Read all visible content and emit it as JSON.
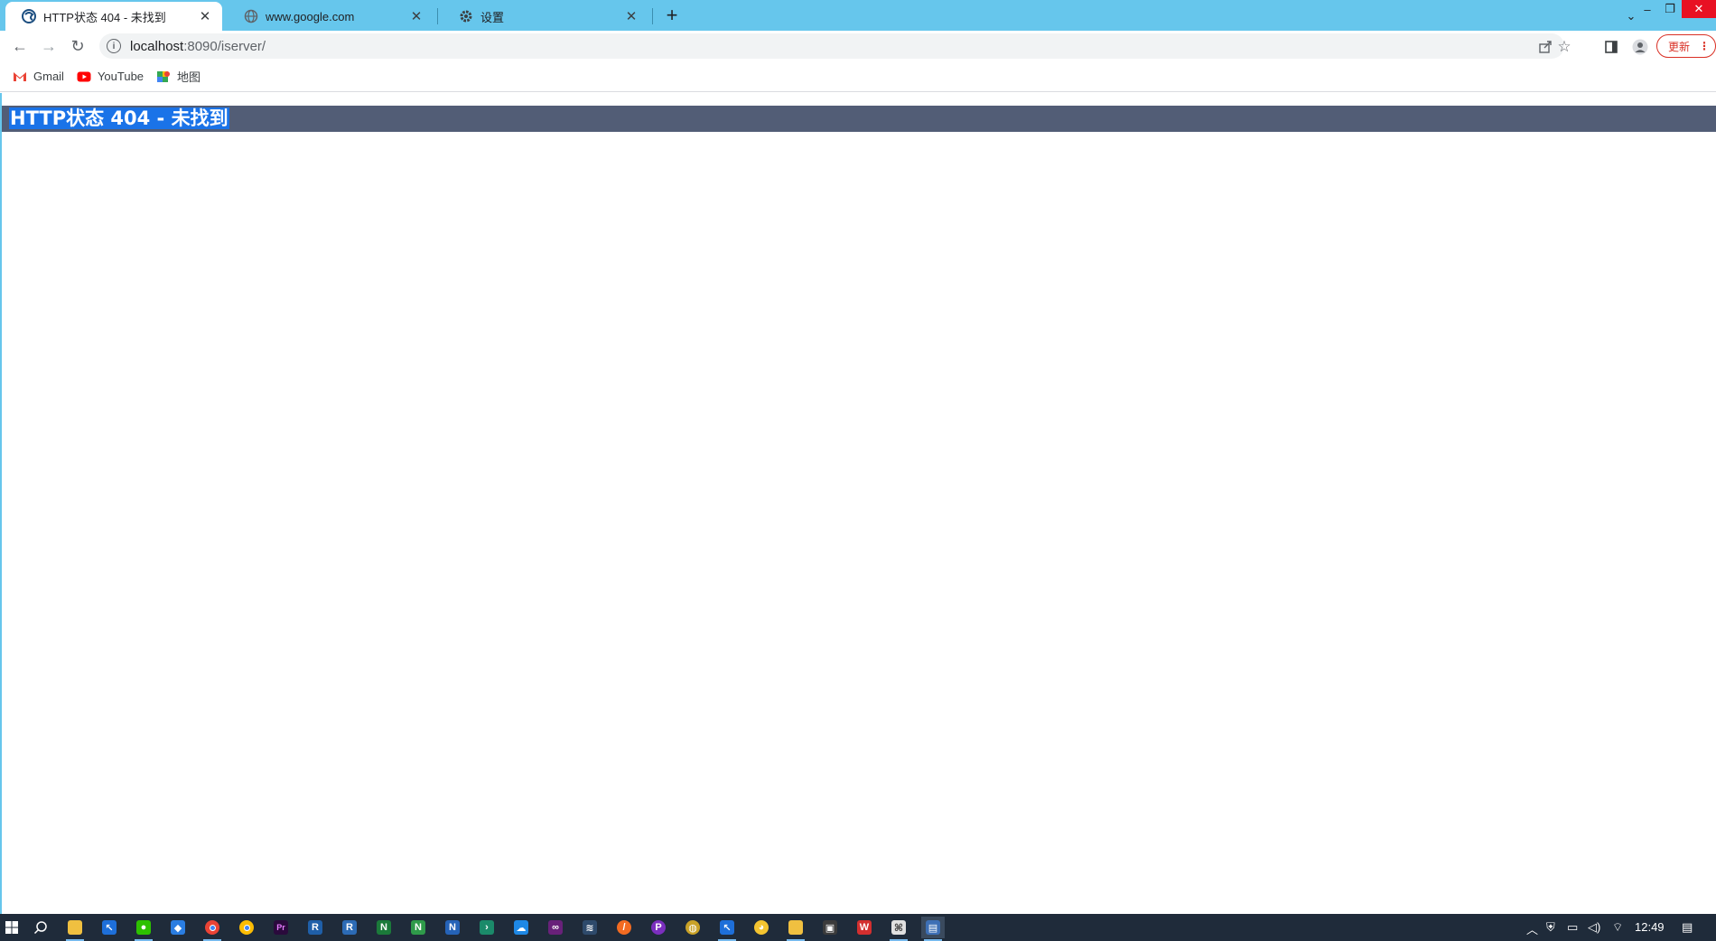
{
  "tabs": [
    {
      "label": "HTTP状态 404 - 未找到",
      "favicon": "supermap-icon",
      "active": true
    },
    {
      "label": "www.google.com",
      "favicon": "globe-icon",
      "active": false
    },
    {
      "label": "设置",
      "favicon": "gear-icon",
      "active": false
    }
  ],
  "address_bar": {
    "host": "localhost",
    "path": ":8090/iserver/"
  },
  "bookmarks": [
    {
      "label": "Gmail",
      "icon": "gmail-icon"
    },
    {
      "label": "YouTube",
      "icon": "youtube-icon"
    },
    {
      "label": "地图",
      "icon": "maps-icon"
    }
  ],
  "toolbar": {
    "update_label": "更新"
  },
  "page": {
    "error_title": "HTTP状态 404 - 未找到"
  },
  "taskbar": {
    "clock": "12:49"
  },
  "colors": {
    "tab_strip": "#66c6ec",
    "error_bar": "#525d76",
    "selection": "#1a73e8",
    "taskbar": "#1f2b3a"
  }
}
